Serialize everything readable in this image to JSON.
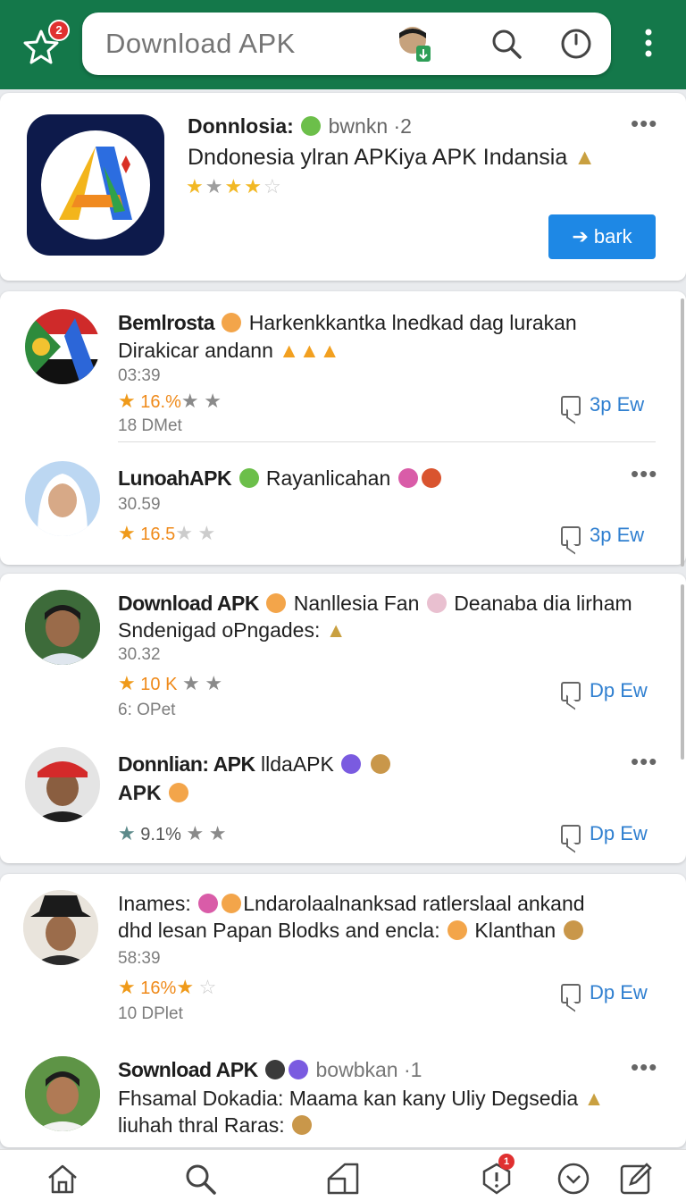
{
  "header": {
    "search_placeholder": "Download APK",
    "star_badge_count": "2",
    "icons": [
      "star-icon",
      "search-icon",
      "clock-icon",
      "more-vert-icon"
    ],
    "color": "#14784a"
  },
  "featured": {
    "app_name": "Donnlosia:",
    "author": "bwnkn ·2",
    "description": "Dndonesia ylran APKiya APK Indansia",
    "rating_stars": 4,
    "button_label": "bark",
    "button_color": "#1e88e5"
  },
  "items": [
    {
      "title_bold": "Bemlrosta",
      "title_rest": "Harkenkkantka lnedkad dag lurakan",
      "line2": "Dirakicar andann",
      "time": "03:39",
      "rating": "16.%",
      "extra": "18 DMet",
      "action": "3p Ew"
    },
    {
      "title_bold": "LunoahAPK",
      "title_rest": "Rayanlicahan",
      "time": "30.59",
      "rating": "16.5",
      "action": "3p Ew"
    },
    {
      "title_bold": "Download APK",
      "title_rest": "Nanllesia Fan",
      "title_rest2": "Deanaba dia lirham",
      "line2": "Sndenigad oPngades:",
      "time": "30.32",
      "rating": "10 K",
      "extra": "6: OPet",
      "action": "Dp Ew"
    },
    {
      "title_bold": "Donnlian: APK",
      "title_rest": "lldaAPK",
      "line2": "APK",
      "rating": "9.1%",
      "action": "Dp Ew"
    },
    {
      "title_rest": "Inames:",
      "title_rest2": "Lndarolaalnanksad ratlerslaal ankand",
      "line2": "dhd lesan Papan Blodks and encla:",
      "line2b": "Klanthan",
      "time": "58:39",
      "rating": "16%",
      "extra": "10 DPlet",
      "action": "Dp Ew"
    },
    {
      "title_bold": "Sownload APK",
      "author": "bowbkan ·1",
      "line2": "Fhsamal Dokadia: Maama kan kany Uliy Degsedia",
      "line3": "liuhah thral Raras:"
    }
  ],
  "bottom_nav": {
    "icons": [
      "home-icon",
      "search-icon",
      "apps-icon",
      "notification-icon",
      "download-icon",
      "edit-icon"
    ],
    "badge_count": "1"
  }
}
